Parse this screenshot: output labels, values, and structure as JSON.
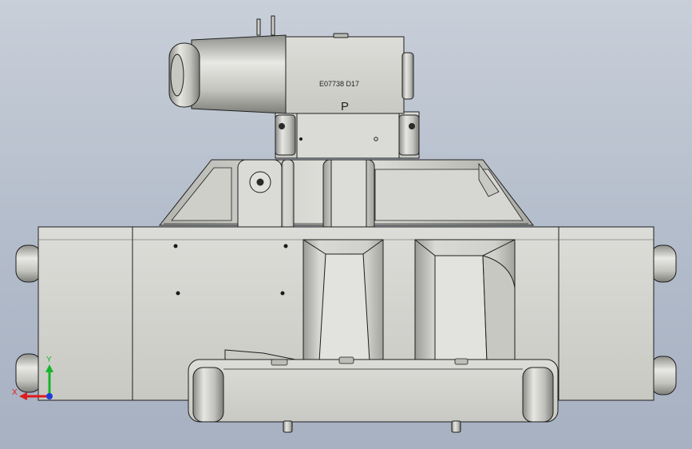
{
  "viewport": {
    "background_top": "#c8cfd9",
    "background_bottom": "#a7b1c2",
    "model_fill": "#d2d2ce",
    "model_shade": "#b9b9b4",
    "model_edge": "#1e1e1e"
  },
  "model": {
    "part_number": "E07738  D17",
    "port_letter": "P"
  },
  "triad": {
    "x_label": "X",
    "y_label": "Y",
    "x_color": "#e01b1b",
    "y_color": "#15b52b",
    "z_color": "#1f3bd8"
  }
}
